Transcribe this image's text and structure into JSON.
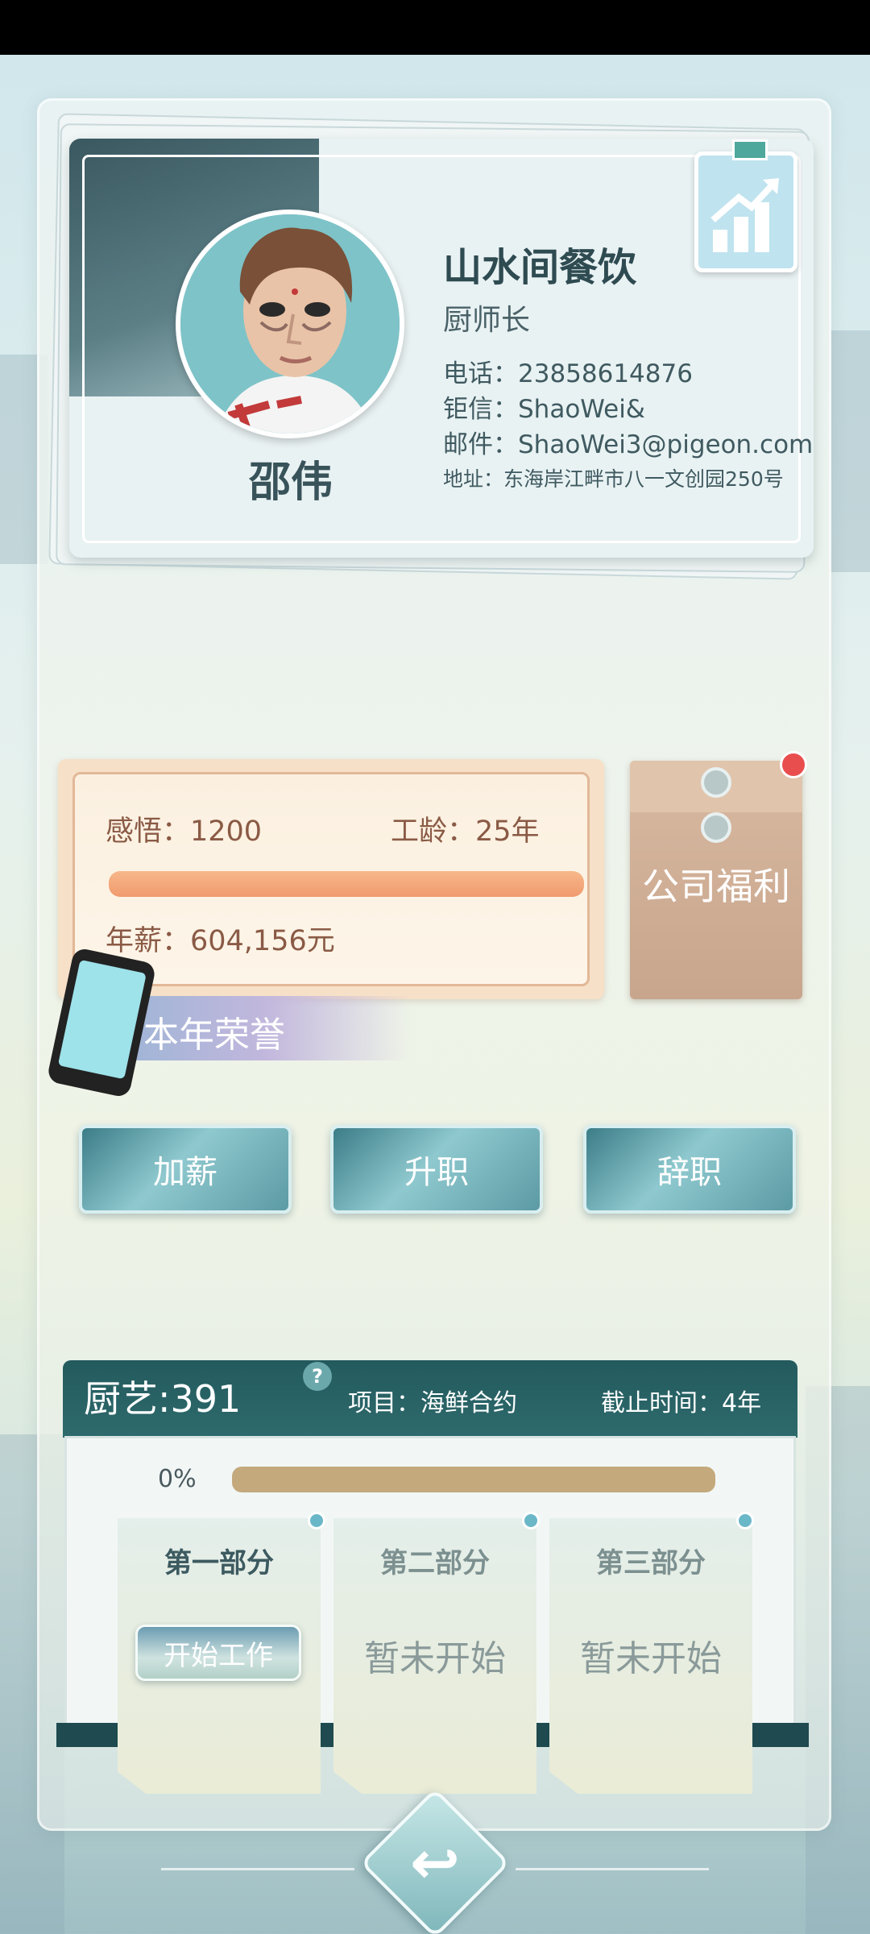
{
  "profile": {
    "name": "邵伟",
    "company": "山水间餐饮",
    "title": "厨师长",
    "phone": "电话：23858614876",
    "chat": "钜信：ShaoWei&",
    "email": "邮件：ShaoWei3@pigeon.com",
    "address": "地址：东海岸江畔市八一文创园250号"
  },
  "stats": {
    "insight": "感悟：1200",
    "seniority": "工龄：25年",
    "salary": "年薪：604,156元",
    "insight_progress": 1.0
  },
  "welfare": {
    "label": "公司福利"
  },
  "honor": {
    "label": "本年荣誉"
  },
  "actions": {
    "raise": "加薪",
    "promote": "升职",
    "resign": "辞职"
  },
  "project": {
    "skill": "厨艺:391",
    "help": "?",
    "name": "项目：海鲜合约",
    "deadline": "截止时间：4年",
    "progress_label": "0%",
    "progress": 0.0,
    "parts": [
      {
        "title": "第一部分",
        "button": "开始工作"
      },
      {
        "title": "第二部分",
        "status": "暂未开始"
      },
      {
        "title": "第三部分",
        "status": "暂未开始"
      }
    ]
  },
  "colors": {
    "header_teal": "#235a5e",
    "accent_orange": "#f09a6e",
    "notification_red": "#e94e4e"
  },
  "icons": {
    "chart": "growth-chart-icon",
    "phone": "phone-icon",
    "back": "back-arrow-icon"
  }
}
